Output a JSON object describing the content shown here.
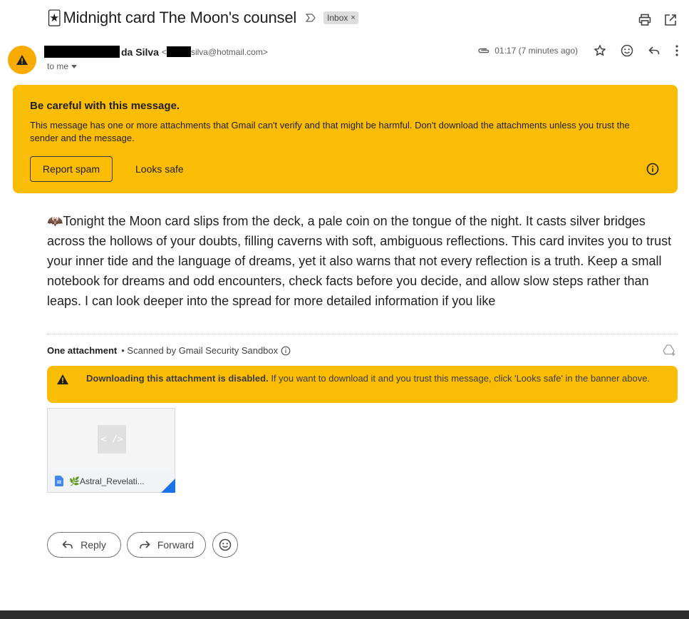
{
  "email": {
    "subject_emoji": "🃏",
    "subject": "Midnight card The Moon's counsel",
    "label": "Inbox",
    "label_remove": "×"
  },
  "sender": {
    "name_suffix": "da Silva",
    "email_prefix": "<",
    "email_suffix": "silva@hotmail.com>",
    "recipient": "to me",
    "timestamp": "01:17 (7 minutes ago)"
  },
  "warning_banner": {
    "title": "Be careful with this message.",
    "text": "This message has one or more attachments that Gmail can't verify and that might be harmful. Don't download the attachments unless you trust the sender and the message.",
    "report_spam_label": "Report spam",
    "looks_safe_label": "Looks safe"
  },
  "body": {
    "emoji": "🦇",
    "text": "Tonight the Moon card slips from the deck, a pale coin on the tongue of the night. It casts silver bridges across the hollows of your doubts, filling caverns with soft, ambiguous reflections. This card invites you to trust your inner tide and the language of dreams, yet it also warns that not every reflection is a truth. Keep a small notebook for dreams and odd encounters, check facts before you decide, and allow slow steps rather than leaps. I can look deeper into the spread for more detailed information if you like"
  },
  "attachments": {
    "count_label": "One attachment",
    "scanned_label": "• Scanned by Gmail Security Sandbox",
    "download_disabled_bold": "Downloading this attachment is disabled.",
    "download_disabled_text": " If you want to download it and you trust this message, click 'Looks safe' in the banner above.",
    "preview_glyph": "< />",
    "file_name": "🌿Astral_Revelati..."
  },
  "actions": {
    "reply_label": "Reply",
    "forward_label": "Forward"
  },
  "colors": {
    "warning": "#fbbc04",
    "avatar": "#f9ab00",
    "file_blue": "#1a73e8"
  }
}
